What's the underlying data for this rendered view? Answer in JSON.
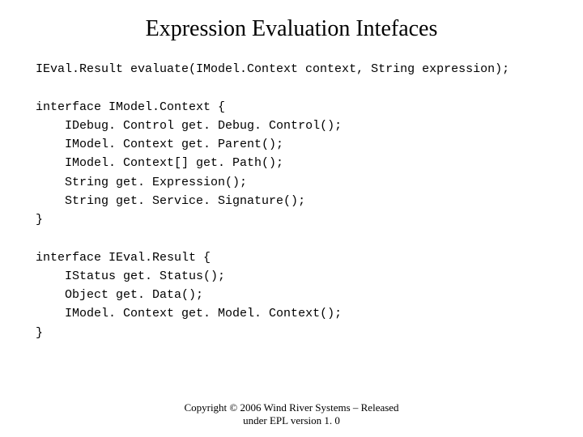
{
  "title": "Expression Evaluation Intefaces",
  "code": {
    "sig": "IEval.Result evaluate(IModel.Context context, String expression);",
    "iface1_open": "interface IModel.Context {",
    "iface1_m1": "IDebug. Control get. Debug. Control();",
    "iface1_m2": "IModel. Context get. Parent();",
    "iface1_m3": "IModel. Context[] get. Path();",
    "iface1_m4": "String get. Expression();",
    "iface1_m5": "String get. Service. Signature();",
    "iface1_close": "}",
    "iface2_open": "interface IEval.Result {",
    "iface2_m1": "IStatus get. Status();",
    "iface2_m2": "Object get. Data();",
    "iface2_m3": "IModel. Context get. Model. Context();",
    "iface2_close": "}"
  },
  "footer": {
    "line1": "Copyright © 2006 Wind River Systems – Released",
    "line2": "under EPL version 1. 0"
  }
}
